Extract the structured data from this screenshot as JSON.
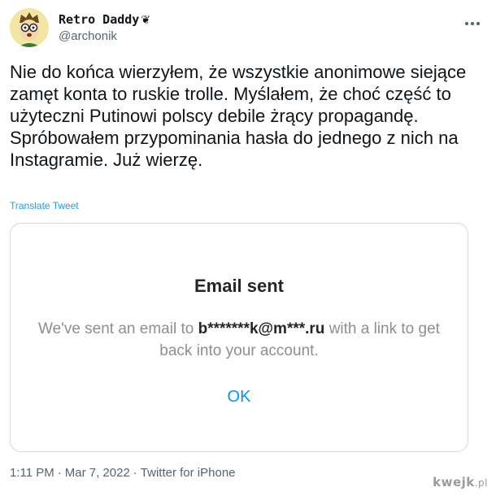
{
  "tweet": {
    "display_name": "Retro Daddy",
    "name_emoji": "❦",
    "handle": "@archonik",
    "more_icon": "ellipsis-icon",
    "paragraphs": [
      "Nie do końca wierzyłem, że wszystkie anonimowe siejące zamęt konta to ruskie trolle. Myślałem, że choć część to użyteczni Putinowi polscy debile żrący propagandę.",
      "Spróbowałem przypominania hasła do jednego z nich na Instagramie. Już wierzę."
    ],
    "translate_label": "Translate Tweet",
    "time": "1:11 PM",
    "separator": "·",
    "date": "Mar 7, 2022",
    "source": "Twitter for iPhone"
  },
  "dialog": {
    "title": "Email sent",
    "body_prefix": "We've sent an email to ",
    "email": "b*******k@m***.ru",
    "body_suffix": " with a link to get back into your account.",
    "ok_label": "OK"
  },
  "watermark": {
    "text": "kwejk",
    "suffix": ".pl"
  },
  "colors": {
    "link": "#1d9bf0",
    "instagram_blue": "#0095f6",
    "secondary_text": "#536471",
    "border": "#cfd9de"
  }
}
